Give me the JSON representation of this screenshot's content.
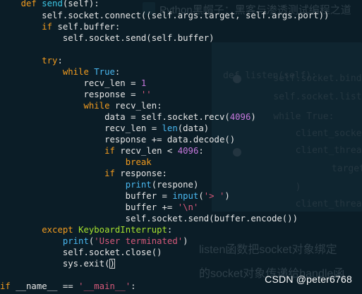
{
  "colors": {
    "background": "#0b1d27",
    "keyword": "#f39c1f",
    "function_name": "#3ec7e6",
    "builtin": "#4ab8f0",
    "number": "#c678dd",
    "string": "#d7597a",
    "exception": "#a6e22e",
    "default_text": "#e6e6e6"
  },
  "code": {
    "lines": [
      {
        "name": "line-def-send",
        "tokens": [
          {
            "t": "    ",
            "c": ""
          },
          {
            "t": "def ",
            "c": "kw"
          },
          {
            "t": "send",
            "c": "fn"
          },
          {
            "t": "(self):",
            "c": ""
          }
        ]
      },
      {
        "name": "line-connect",
        "tokens": [
          {
            "t": "        self.socket.connect((self.args.target, self.args.port))",
            "c": ""
          }
        ]
      },
      {
        "name": "line-if-buffer",
        "tokens": [
          {
            "t": "        ",
            "c": ""
          },
          {
            "t": "if ",
            "c": "kw"
          },
          {
            "t": "self.buffer:",
            "c": ""
          }
        ]
      },
      {
        "name": "line-send-buffer",
        "tokens": [
          {
            "t": "            self.socket.send(self.buffer)",
            "c": ""
          }
        ]
      },
      {
        "name": "line-blank-1",
        "tokens": []
      },
      {
        "name": "line-try",
        "tokens": [
          {
            "t": "        ",
            "c": ""
          },
          {
            "t": "try",
            "c": "kw"
          },
          {
            "t": ":",
            "c": ""
          }
        ]
      },
      {
        "name": "line-while-true",
        "tokens": [
          {
            "t": "            ",
            "c": ""
          },
          {
            "t": "while ",
            "c": "kw"
          },
          {
            "t": "True",
            "c": "true"
          },
          {
            "t": ":",
            "c": ""
          }
        ]
      },
      {
        "name": "line-recv-len",
        "tokens": [
          {
            "t": "                recv_len = ",
            "c": ""
          },
          {
            "t": "1",
            "c": "num"
          }
        ]
      },
      {
        "name": "line-response",
        "tokens": [
          {
            "t": "                response = ",
            "c": ""
          },
          {
            "t": "''",
            "c": "str"
          }
        ]
      },
      {
        "name": "line-while-recv",
        "tokens": [
          {
            "t": "                ",
            "c": ""
          },
          {
            "t": "while ",
            "c": "kw"
          },
          {
            "t": "recv_len:",
            "c": ""
          }
        ]
      },
      {
        "name": "line-data-recv",
        "tokens": [
          {
            "t": "                    data = self.socket.recv(",
            "c": ""
          },
          {
            "t": "4096",
            "c": "num"
          },
          {
            "t": ")",
            "c": ""
          }
        ]
      },
      {
        "name": "line-len-data",
        "tokens": [
          {
            "t": "                    recv_len = ",
            "c": ""
          },
          {
            "t": "len",
            "c": "builtin"
          },
          {
            "t": "(data)",
            "c": ""
          }
        ]
      },
      {
        "name": "line-decode",
        "tokens": [
          {
            "t": "                    response += data.decode()",
            "c": ""
          }
        ]
      },
      {
        "name": "line-if-recv-lt",
        "tokens": [
          {
            "t": "                    ",
            "c": ""
          },
          {
            "t": "if ",
            "c": "kw"
          },
          {
            "t": "recv_len < ",
            "c": ""
          },
          {
            "t": "4096",
            "c": "num"
          },
          {
            "t": ":",
            "c": ""
          }
        ]
      },
      {
        "name": "line-break",
        "tokens": [
          {
            "t": "                        ",
            "c": ""
          },
          {
            "t": "break",
            "c": "kw"
          }
        ]
      },
      {
        "name": "line-if-response",
        "tokens": [
          {
            "t": "                    ",
            "c": ""
          },
          {
            "t": "if ",
            "c": "kw"
          },
          {
            "t": "response:",
            "c": ""
          }
        ]
      },
      {
        "name": "line-print-respone",
        "tokens": [
          {
            "t": "                        ",
            "c": ""
          },
          {
            "t": "print",
            "c": "builtin"
          },
          {
            "t": "(respone)",
            "c": ""
          }
        ]
      },
      {
        "name": "line-buffer-input",
        "tokens": [
          {
            "t": "                        buffer = ",
            "c": ""
          },
          {
            "t": "input",
            "c": "builtin"
          },
          {
            "t": "(",
            "c": ""
          },
          {
            "t": "'> '",
            "c": "str"
          },
          {
            "t": ")",
            "c": ""
          }
        ]
      },
      {
        "name": "line-buffer-newline",
        "tokens": [
          {
            "t": "                        buffer += ",
            "c": ""
          },
          {
            "t": "'\\n'",
            "c": "str"
          }
        ]
      },
      {
        "name": "line-send-encode",
        "tokens": [
          {
            "t": "                        self.socket.send(buffer.encode())",
            "c": ""
          }
        ]
      },
      {
        "name": "line-except",
        "tokens": [
          {
            "t": "        ",
            "c": ""
          },
          {
            "t": "except ",
            "c": "kw"
          },
          {
            "t": "KeyboardInterrupt",
            "c": "exc"
          },
          {
            "t": ":",
            "c": ""
          }
        ]
      },
      {
        "name": "line-print-terminated",
        "tokens": [
          {
            "t": "            ",
            "c": ""
          },
          {
            "t": "print",
            "c": "builtin"
          },
          {
            "t": "(",
            "c": ""
          },
          {
            "t": "'User terminated'",
            "c": "str"
          },
          {
            "t": ")",
            "c": ""
          }
        ]
      },
      {
        "name": "line-socket-close",
        "tokens": [
          {
            "t": "            self.socket.close()",
            "c": ""
          }
        ]
      },
      {
        "name": "line-sys-exit",
        "tokens": [
          {
            "t": "            sys.exit(",
            "c": ""
          },
          {
            "t": ")",
            "c": "cursor"
          }
        ]
      },
      {
        "name": "line-blank-2",
        "tokens": []
      },
      {
        "name": "line-if-main",
        "tokens": [
          {
            "t": "if ",
            "c": "kw"
          },
          {
            "t": "__name__ == ",
            "c": ""
          },
          {
            "t": "'__main__'",
            "c": "str"
          },
          {
            "t": ":",
            "c": ""
          }
        ]
      }
    ]
  },
  "ghost": {
    "title": "Python黑帽子：黑客与渗透测试编程之道",
    "code_lines": [
      "def listen(self):",
      "    self.socket.bind(",
      "    self.socket.listen(",
      "    while True:",
      "        client_socket",
      "        client_thread =",
      "            target=se",
      "        )",
      "        client_thread."
    ],
    "para_1": "listen函数把socket对象绑定",
    "para_2": "的socket对象传递给handle函"
  },
  "watermark": "CSDN @peter6768"
}
